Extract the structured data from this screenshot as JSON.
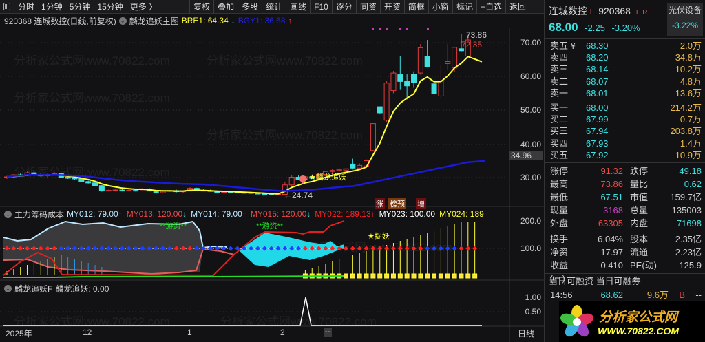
{
  "toolbar": {
    "period_items": [
      "分时",
      "1分钟",
      "5分钟",
      "15分钟",
      "更多 〉"
    ],
    "buttons": [
      "复权",
      "叠加",
      "多股",
      "统计",
      "画线",
      "F10",
      "逐分",
      "同资",
      "开资",
      "简框",
      "小窗",
      "标记",
      "+自选",
      "返回"
    ]
  },
  "info": {
    "title": "920368 连城数控(日线,前复权)",
    "indicator": "麟龙追妖主图",
    "bre1": "BRE1: 64.34",
    "bgy1": "BGY1: 36.68"
  },
  "main_chart": {
    "price_axis": [
      "70.00",
      "60.00",
      "50.00",
      "40.00",
      "30.00"
    ],
    "current_ma_label": "34.96",
    "high_label": "73.86",
    "last_label": "72.35",
    "low_label": "←24.74",
    "signal_label": "★麟龙追妖",
    "event_tags": [
      "涨",
      "榜预",
      "增"
    ],
    "colors": {
      "up": "#e03a3a",
      "down": "#3ee0e0",
      "ma_fast": "#ffff33",
      "ma_slow": "#1a1ad8"
    },
    "candles": [
      [
        30,
        30.5,
        29.6,
        30.2
      ],
      [
        30.2,
        31,
        30,
        30.8
      ],
      [
        30.8,
        31.2,
        30.4,
        30.6
      ],
      [
        30.6,
        31.8,
        30.4,
        31.4
      ],
      [
        31.4,
        32.2,
        31,
        30.8
      ],
      [
        30.8,
        31.2,
        30.2,
        30.5
      ],
      [
        30.5,
        31.2,
        29.8,
        30.9
      ],
      [
        30.9,
        31.6,
        30.6,
        31.2
      ],
      [
        31.2,
        31.5,
        30.2,
        30.1
      ],
      [
        30.1,
        30.6,
        29.6,
        29.8
      ],
      [
        29.8,
        30.2,
        29.4,
        29.6
      ],
      [
        29.6,
        29.9,
        28.6,
        28.8
      ],
      [
        28.8,
        29.1,
        28.2,
        28.4
      ],
      [
        28.4,
        28.8,
        27.5,
        27.6
      ],
      [
        27.6,
        27.8,
        25.8,
        26.1
      ],
      [
        26.1,
        26.4,
        25.9,
        26.2
      ],
      [
        26.2,
        26.5,
        25.9,
        26.3
      ],
      [
        26.3,
        26.6,
        25.9,
        26.0
      ],
      [
        26,
        26.5,
        25.8,
        26.2
      ],
      [
        26.2,
        26.5,
        25.8,
        26.1
      ],
      [
        26.1,
        26.8,
        25.9,
        26.6
      ],
      [
        26.6,
        26.9,
        25.9,
        26.0
      ],
      [
        26,
        26.3,
        25.2,
        25.5
      ],
      [
        25.5,
        26.1,
        25.3,
        25.9
      ],
      [
        25.9,
        26.2,
        25.8,
        26.1
      ],
      [
        26.1,
        26.4,
        25.6,
        25.8
      ],
      [
        25.8,
        26.2,
        25.4,
        26.0
      ],
      [
        26,
        27.1,
        25.9,
        26.8
      ],
      [
        26.8,
        27,
        26.1,
        26.2
      ],
      [
        26.2,
        26.5,
        25.9,
        26.1
      ],
      [
        26.1,
        26.4,
        25.8,
        25.9
      ],
      [
        25.9,
        26.2,
        25.4,
        25.6
      ],
      [
        25.6,
        25.9,
        25.4,
        25.8
      ],
      [
        25.8,
        26.1,
        25.6,
        25.7
      ],
      [
        25.7,
        26,
        25.3,
        25.4
      ],
      [
        25.4,
        25.8,
        25.2,
        25.5
      ],
      [
        25.5,
        25.7,
        25.2,
        25.3
      ],
      [
        25.3,
        25.6,
        25.0,
        25.2
      ],
      [
        25.2,
        25.5,
        24.9,
        25.1
      ],
      [
        25.1,
        25.4,
        24.8,
        24.9
      ],
      [
        24.9,
        25.2,
        24.74,
        25.0
      ],
      [
        25,
        28.6,
        24.9,
        27.8
      ],
      [
        27.8,
        30.6,
        27.6,
        30.1
      ],
      [
        30.1,
        30.6,
        29.2,
        29.4
      ],
      [
        29.4,
        30.4,
        29,
        30.2
      ],
      [
        30.2,
        30.8,
        29.6,
        29.8
      ],
      [
        29.8,
        31.2,
        29.5,
        30.9
      ],
      [
        30.9,
        32,
        30.6,
        31.8
      ],
      [
        31.8,
        32.6,
        31.2,
        32.1
      ],
      [
        32.1,
        32.8,
        31.6,
        32.4
      ],
      [
        32.2,
        34.6,
        32,
        32.6
      ],
      [
        34,
        35.6,
        32.4,
        32.8
      ],
      [
        32.8,
        34.2,
        32.2,
        33.6
      ],
      [
        33.4,
        35.4,
        33,
        35
      ],
      [
        38,
        46,
        38,
        46
      ],
      [
        51,
        50.5,
        49,
        49.2
      ],
      [
        47,
        58.6,
        46.4,
        58
      ],
      [
        55.8,
        61.6,
        55,
        61
      ],
      [
        60.5,
        66,
        56,
        58.5
      ],
      [
        58.6,
        60.8,
        53.2,
        57.2
      ],
      [
        60.7,
        61.5,
        56.6,
        58.2
      ],
      [
        61,
        69.6,
        60.5,
        68.5
      ],
      [
        66,
        70.8,
        62.8,
        62.8
      ],
      [
        57.8,
        59.4,
        53.9,
        54.8
      ],
      [
        54.2,
        63.4,
        53.6,
        58.6
      ],
      [
        63.8,
        69.6,
        62,
        64.4
      ],
      [
        62.5,
        68.7,
        61.4,
        68.6
      ],
      [
        68.2,
        72.6,
        67.4,
        67.6
      ],
      [
        66,
        72.3,
        65.6,
        70.8
      ]
    ]
  },
  "indicator1": {
    "name": "主力筹码成本",
    "values": [
      {
        "label": "MY012: 79.00",
        "arrow": "up",
        "color": "#bfe6ff"
      },
      {
        "label": "MY013: 120.00",
        "arrow": "down",
        "color": "#e84a4a"
      },
      {
        "label": "MY014: 79.00",
        "arrow": "up",
        "color": "#bfe6ff"
      },
      {
        "label": "MY015: 120.00",
        "arrow": "down",
        "color": "#e84a4a"
      },
      {
        "label": "MY022: 189.13",
        "arrow": "up",
        "color": "#ff2020"
      },
      {
        "label": "MY023: 100.00",
        "arrow": "",
        "color": "#ffffff"
      },
      {
        "label": "MY024: 189",
        "arrow": "",
        "color": "#ffff33"
      }
    ],
    "axis": [
      "200.0",
      "100.0"
    ],
    "labels": [
      "**游资**",
      "**游资**",
      "★捉妖"
    ]
  },
  "indicator2": {
    "name": "麟龙追妖F",
    "value": "麟龙追妖: 0.00",
    "axis": [
      "1.00",
      "0.50"
    ]
  },
  "time_axis": {
    "labels": [
      "2025年",
      "12",
      "1",
      "2"
    ],
    "dash": "--",
    "period": "日线"
  },
  "quote": {
    "name": "连城数控",
    "code": "920368",
    "badges": [
      "i",
      "L",
      "R"
    ],
    "sector": "光伏设备",
    "sector_change": "-3.22%",
    "price": "68.00",
    "change": "-2.25",
    "change_pct": "-3.20%",
    "asks": [
      {
        "label": "卖五 ¥",
        "price": "68.30",
        "vol": "2.0万"
      },
      {
        "label": "卖四",
        "price": "68.20",
        "vol": "34.8万"
      },
      {
        "label": "卖三",
        "price": "68.14",
        "vol": "10.2万"
      },
      {
        "label": "卖二",
        "price": "68.07",
        "vol": "4.8万"
      },
      {
        "label": "卖一",
        "price": "68.01",
        "vol": "13.6万"
      }
    ],
    "bids": [
      {
        "label": "买一",
        "price": "68.00",
        "vol": "214.2万"
      },
      {
        "label": "买二",
        "price": "67.99",
        "vol": "0.7万"
      },
      {
        "label": "买三",
        "price": "67.94",
        "vol": "203.8万"
      },
      {
        "label": "买四",
        "price": "67.93",
        "vol": "1.4万"
      },
      {
        "label": "买五",
        "price": "67.92",
        "vol": "10.9万"
      }
    ],
    "stats": [
      [
        "涨停",
        "91.32",
        "#e84a4a",
        "跌停",
        "49.18",
        "#3ee0e0"
      ],
      [
        "最高",
        "73.86",
        "#e84a4a",
        "量比",
        "0.62",
        "#3ee0e0"
      ],
      [
        "最低",
        "67.51",
        "#3ee0e0",
        "市值",
        "159.7亿",
        "#ccc"
      ],
      [
        "现量",
        "3168",
        "#c040c0",
        "总量",
        "135003",
        "#ccc"
      ],
      [
        "外盘",
        "63305",
        "#e84a4a",
        "内盘",
        "71698",
        "#3ee0e0"
      ]
    ],
    "stats2": [
      [
        "换手",
        "6.04%",
        "股本",
        "2.35亿"
      ],
      [
        "净资",
        "17.97",
        "流通",
        "2.23亿"
      ],
      [
        "收益(三)",
        "0.410",
        "PE(动)",
        "125.9"
      ]
    ],
    "margin_header": "当日可融资 当日可融券",
    "trades": [
      {
        "time": "14:56",
        "price": "68.62",
        "vol": "9.6万",
        "side": "B",
        "extra": "--"
      }
    ]
  },
  "watermark": {
    "text": "分析家公式网www.70822.com",
    "logo_cn": "分析家公式网",
    "logo_url": "WWW.70822.COM"
  }
}
